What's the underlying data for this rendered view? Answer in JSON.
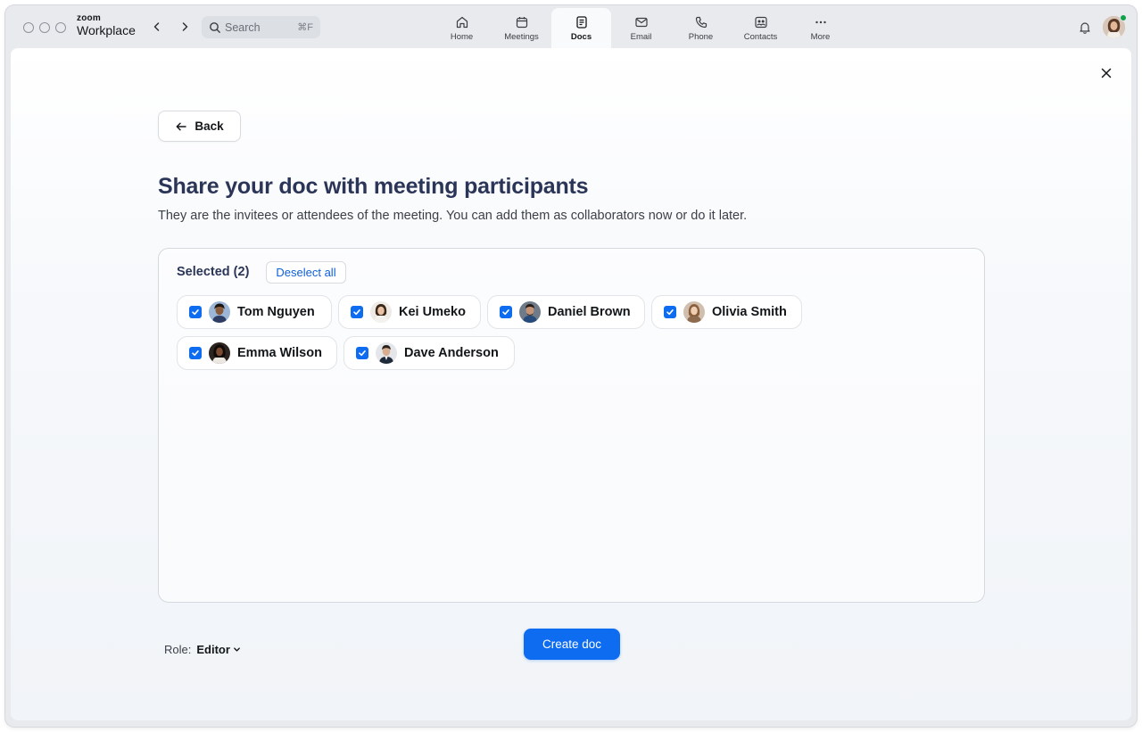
{
  "app": {
    "brand_small": "zoom",
    "brand_large": "Workplace"
  },
  "search": {
    "placeholder": "Search",
    "shortcut": "⌘F"
  },
  "tabs": [
    {
      "label": "Home",
      "icon": "home-icon"
    },
    {
      "label": "Meetings",
      "icon": "calendar-icon"
    },
    {
      "label": "Docs",
      "icon": "doc-icon",
      "active": true
    },
    {
      "label": "Email",
      "icon": "mail-icon"
    },
    {
      "label": "Phone",
      "icon": "phone-icon"
    },
    {
      "label": "Contacts",
      "icon": "contacts-icon"
    },
    {
      "label": "More",
      "icon": "more-icon"
    }
  ],
  "user": {
    "status": "online",
    "status_color": "#12a14b"
  },
  "page": {
    "back_label": "Back",
    "title": "Share your doc with meeting participants",
    "subtitle": "They are the invitees or attendees of the meeting. You can add them as collaborators now or do it later."
  },
  "selection": {
    "label": "Selected (2)",
    "deselect_label": "Deselect all",
    "participants": [
      {
        "name": "Tom Nguyen",
        "checked": true
      },
      {
        "name": "Kei Umeko",
        "checked": true
      },
      {
        "name": "Daniel Brown",
        "checked": true
      },
      {
        "name": "Olivia Smith",
        "checked": true
      },
      {
        "name": "Emma Wilson",
        "checked": true
      },
      {
        "name": "Dave Anderson",
        "checked": true
      }
    ]
  },
  "footer": {
    "role_label": "Role:",
    "role_value": "Editor",
    "create_label": "Create doc"
  },
  "colors": {
    "accent": "#0e6cf0",
    "heading": "#2a3558"
  }
}
